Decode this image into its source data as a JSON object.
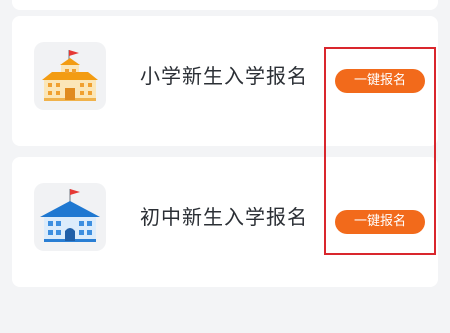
{
  "cards": [
    {
      "title": "小学新生入学报名",
      "button_label": "一键报名",
      "icon": "primary-school-icon"
    },
    {
      "title": "初中新生入学报名",
      "button_label": "一键报名",
      "icon": "middle-school-icon"
    }
  ],
  "colors": {
    "page_background": "#f3f4f6",
    "card_background": "#ffffff",
    "button": "#f26a1b",
    "highlight_border": "#d9262d",
    "title_text": "#2b2f35"
  }
}
